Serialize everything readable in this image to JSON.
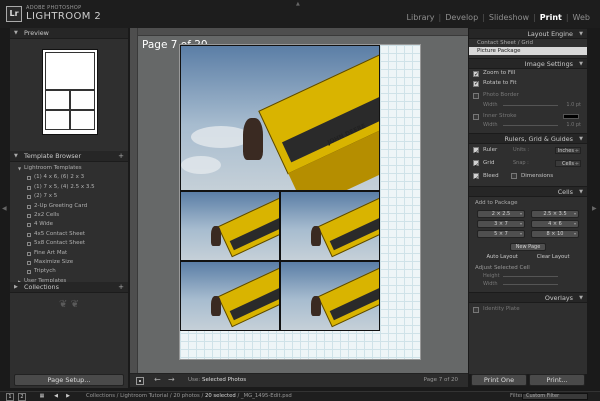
{
  "app": {
    "vendor": "ADOBE PHOTOSHOP",
    "name": "LIGHTROOM 2",
    "logo": "Lr",
    "modules": [
      "Library",
      "Develop",
      "Slideshow",
      "Print",
      "Web"
    ],
    "active_module": "Print",
    "separator": "|"
  },
  "left": {
    "preview_title": "Preview",
    "template_browser_title": "Template Browser",
    "lightroom_templates_label": "Lightroom Templates",
    "templates": [
      "(1) 4 x 6, (6) 2 x 3",
      "(1) 7 x 5, (4) 2.5 x 3.5",
      "(2) 7 x 5",
      "2-Up Greeting Card",
      "2x2 Cells",
      "4 Wide",
      "4x5 Contact Sheet",
      "5x8 Contact Sheet",
      "Fine Art Mat",
      "Maximize Size",
      "Triptych"
    ],
    "user_templates_label": "User Templates",
    "collections_title": "Collections",
    "page_setup_button": "Page Setup..."
  },
  "center": {
    "page_label": "Page 7 of 20",
    "use_label": "Use:",
    "use_value": "Selected Photos",
    "page_count": "Page 7 of 20",
    "photo_text": "JOHN DEERE"
  },
  "right": {
    "layout_engine_title": "Layout Engine",
    "engine_options": [
      "Contact Sheet / Grid",
      "Picture Package"
    ],
    "image_settings_title": "Image Settings",
    "zoom_to_fill": "Zoom to Fill",
    "rotate_to_fit": "Rotate to Fit",
    "photo_border": "Photo Border",
    "width_label": "Width",
    "border_width": "1.0 pt",
    "inner_stroke": "Inner Stroke",
    "stroke_width": "1.0 pt",
    "rulers_title": "Rulers, Grid & Guides",
    "ruler_label": "Ruler",
    "units_label": "Units :",
    "units_value": "Inches",
    "grid_label": "Grid",
    "snap_label": "Snap :",
    "snap_value": "Cells",
    "bleed_label": "Bleed",
    "dimensions_label": "Dimensions",
    "cells_title": "Cells",
    "add_to_package": "Add to Package",
    "sizes": [
      "2 × 2.5",
      "2.5 × 3.5",
      "3 × 7",
      "4 × 6",
      "5 × 7",
      "8 × 10"
    ],
    "new_page": "New Page",
    "auto_layout": "Auto Layout",
    "clear_layout": "Clear Layout",
    "adjust_selected_cell": "Adjust Selected Cell",
    "height_label": "Height",
    "overlays_title": "Overlays",
    "identity_plate": "Identity Plate",
    "print_one_button": "Print One",
    "print_button": "Print..."
  },
  "filmstrip": {
    "screen1": "1",
    "screen2": "2",
    "path_prefix": "Collections / Lightroom Tutorial / 20 photos /",
    "path_selected": "20 selected",
    "path_file": "/ _MG_1495-Edit.psd",
    "filter_label": "Filter :",
    "filter_value": "Custom Filter"
  }
}
